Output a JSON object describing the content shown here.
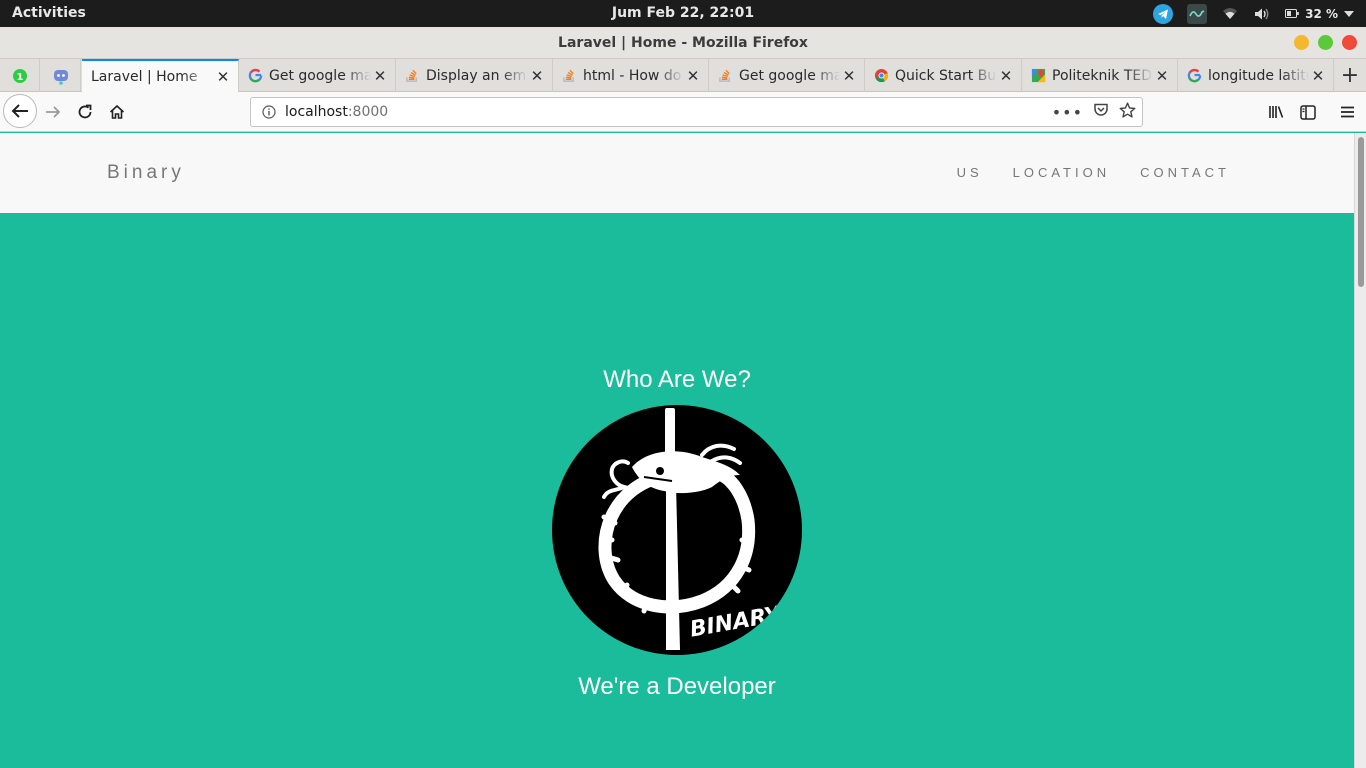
{
  "system": {
    "activities": "Activities",
    "clock": "Jum Feb 22, 22:01",
    "battery": "32 %"
  },
  "window": {
    "title": "Laravel | Home - Mozilla Firefox"
  },
  "tabs": [
    {
      "label": "Laravel | Home",
      "favicon": "page-icon",
      "active": true
    },
    {
      "label": "Get google maps",
      "favicon": "google-icon"
    },
    {
      "label": "Display an embedded",
      "favicon": "stackoverflow-icon"
    },
    {
      "label": "html - How do",
      "favicon": "stackoverflow-icon"
    },
    {
      "label": "Get google maps",
      "favicon": "stackoverflow-icon"
    },
    {
      "label": "Quick Start Builder",
      "favicon": "chrome-icon"
    },
    {
      "label": "Politeknik TEDC",
      "favicon": "maps-icon"
    },
    {
      "label": "longitude latitude",
      "favicon": "google-icon"
    }
  ],
  "urlbar": {
    "host": "localhost",
    "port": ":8000"
  },
  "site": {
    "brand": "Binary",
    "menu": [
      "US",
      "LOCATION",
      "CONTACT"
    ],
    "hero_title": "Who Are We?",
    "hero_sub": "We're a Developer",
    "logo_text": "BINARY"
  },
  "colors": {
    "page_bg": "#1bbc9b",
    "nav_bg": "#f8f8f8",
    "accent_tab": "#0a84ff"
  }
}
